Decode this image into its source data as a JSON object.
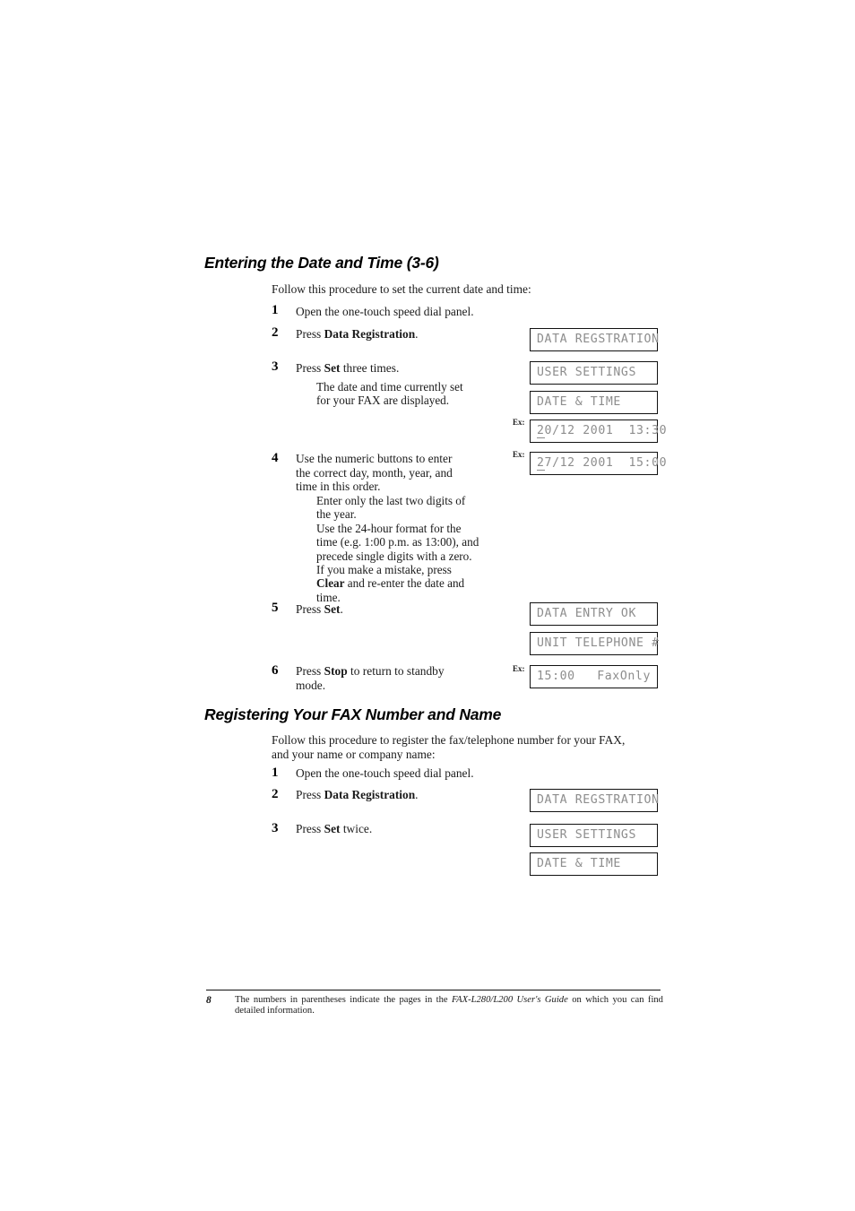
{
  "document": {
    "page_number": "8",
    "footer_note_part1": "The numbers in parentheses indicate the pages in the ",
    "footer_note_italic": "FAX-L280/L200 User's Guide",
    "footer_note_part2": " on which you can find detailed information."
  },
  "section1": {
    "heading": "Entering the Date and Time (3-6)",
    "intro": "Follow this procedure to set the current date and time:",
    "steps": [
      {
        "num": "1",
        "text": "Open the one-touch speed dial panel."
      },
      {
        "num": "2",
        "text_pre": "Press ",
        "text_bold": "Data Registration",
        "text_post": "."
      },
      {
        "num": "3",
        "text_pre": "Press ",
        "text_bold": "Set",
        "text_post": " three times.",
        "sub": "The date and time currently set\nfor your FAX are displayed."
      },
      {
        "num": "4",
        "text": "Use the numeric buttons to enter\nthe correct day, month, year, and\ntime in this order.",
        "sub_line1": "Enter only the last two digits of",
        "sub_line2": "the year.",
        "sub_line3": "Use the 24-hour format for the",
        "sub_line4": "time (e.g. 1:00 p.m. as 13:00), and",
        "sub_line5": "precede single digits with a zero.",
        "sub_line6": "If you make a mistake, press",
        "sub_line7_bold": "Clear",
        "sub_line7_rest": " and re-enter the date and",
        "sub_line8": "time."
      },
      {
        "num": "5",
        "text_pre": "Press ",
        "text_bold": "Set",
        "text_post": "."
      },
      {
        "num": "6",
        "text_pre": "Press ",
        "text_bold": "Stop",
        "text_post": " to return to standby\nmode."
      }
    ],
    "displays": [
      {
        "text": "DATA REGSTRATION",
        "ex": ""
      },
      {
        "text": "USER SETTINGS",
        "ex": ""
      },
      {
        "text": "DATE & TIME",
        "ex": ""
      },
      {
        "cursor": "2",
        "text": "0/12 2001  13:30",
        "ex": "Ex:"
      },
      {
        "cursor": "2",
        "text": "7/12 2001  15:00",
        "ex": "Ex:"
      },
      {
        "text": "DATA ENTRY OK",
        "ex": ""
      },
      {
        "text": "UNIT TELEPHONE #",
        "ex": ""
      },
      {
        "left": "15:00",
        "right": "FaxOnly",
        "ex": "Ex:"
      }
    ]
  },
  "section2": {
    "heading": "Registering Your FAX Number and Name",
    "intro": "Follow this procedure to register the fax/telephone number for your FAX,\nand your name or company name:",
    "steps": [
      {
        "num": "1",
        "text": "Open the one-touch speed dial panel."
      },
      {
        "num": "2",
        "text_pre": "Press ",
        "text_bold": "Data Registration",
        "text_post": "."
      },
      {
        "num": "3",
        "text_pre": "Press ",
        "text_bold": "Set",
        "text_post": " twice."
      }
    ],
    "displays": [
      {
        "text": "DATA REGSTRATION"
      },
      {
        "text": "USER SETTINGS"
      },
      {
        "text": "DATE & TIME"
      }
    ]
  }
}
